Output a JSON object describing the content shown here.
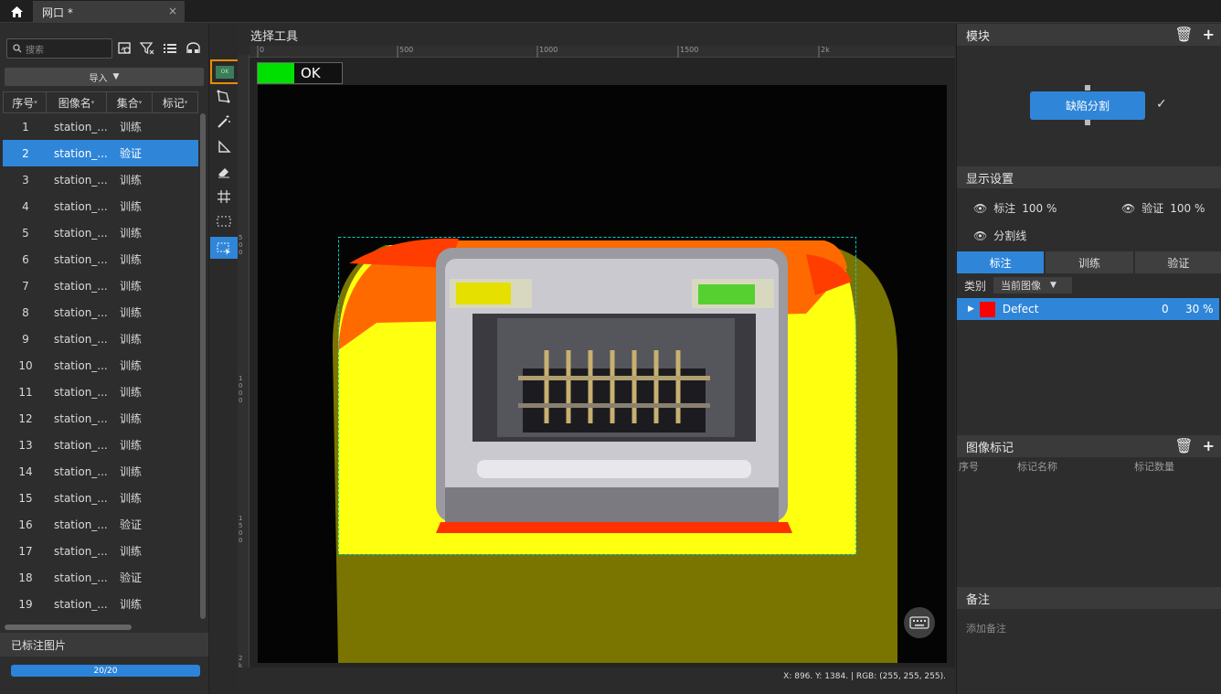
{
  "tabs": {
    "title": "网口 *"
  },
  "left": {
    "search_placeholder": "搜索",
    "import_label": "导入",
    "columns": [
      "序号",
      "图像名",
      "集合",
      "标记"
    ],
    "rows": [
      {
        "no": "1",
        "name": "station_...",
        "set": "训练"
      },
      {
        "no": "2",
        "name": "station_...",
        "set": "验证"
      },
      {
        "no": "3",
        "name": "station_...",
        "set": "训练"
      },
      {
        "no": "4",
        "name": "station_...",
        "set": "训练"
      },
      {
        "no": "5",
        "name": "station_...",
        "set": "训练"
      },
      {
        "no": "6",
        "name": "station_...",
        "set": "训练"
      },
      {
        "no": "7",
        "name": "station_...",
        "set": "训练"
      },
      {
        "no": "8",
        "name": "station_...",
        "set": "训练"
      },
      {
        "no": "9",
        "name": "station_...",
        "set": "训练"
      },
      {
        "no": "10",
        "name": "station_...",
        "set": "训练"
      },
      {
        "no": "11",
        "name": "station_...",
        "set": "训练"
      },
      {
        "no": "12",
        "name": "station_...",
        "set": "训练"
      },
      {
        "no": "13",
        "name": "station_...",
        "set": "训练"
      },
      {
        "no": "14",
        "name": "station_...",
        "set": "训练"
      },
      {
        "no": "15",
        "name": "station_...",
        "set": "训练"
      },
      {
        "no": "16",
        "name": "station_...",
        "set": "验证"
      },
      {
        "no": "17",
        "name": "station_...",
        "set": "训练"
      },
      {
        "no": "18",
        "name": "station_...",
        "set": "验证"
      },
      {
        "no": "19",
        "name": "station_...",
        "set": "训练"
      }
    ],
    "labeled_title": "已标注图片",
    "progress_text": "20/20",
    "progress_fraction": 1.0
  },
  "center": {
    "title": "选择工具",
    "ruler_ticks": [
      "0",
      "500",
      "1000",
      "1500",
      "2k"
    ],
    "vruler_ticks": [
      "5\n0\n0",
      "1\n0\n0\n0",
      "1\n5\n0\n0",
      "2\nk"
    ],
    "ok_text": "OK",
    "status_text": "X: 896. Y: 1384. | RGB: (255, 255, 255)."
  },
  "right": {
    "module_title": "模块",
    "module_button": "缺陷分割",
    "display_title": "显示设置",
    "display_items": [
      {
        "label": "标注",
        "value": "100 %"
      },
      {
        "label": "验证",
        "value": "100 %"
      },
      {
        "label": "分割线",
        "value": ""
      }
    ],
    "tabs": [
      "标注",
      "训练",
      "验证"
    ],
    "category_label": "类别",
    "category_value": "当前图像",
    "defect": {
      "name": "Defect",
      "count": "0",
      "percent": "30 %",
      "color": "#ff0000"
    },
    "image_tags_title": "图像标记",
    "tag_columns": [
      "序号",
      "标记名称",
      "标记数量"
    ],
    "notes_title": "备注",
    "notes_placeholder": "添加备注"
  },
  "colors": {
    "accent": "#2f86d9",
    "ok_green": "#00e000",
    "highlight": "#f08a00"
  }
}
